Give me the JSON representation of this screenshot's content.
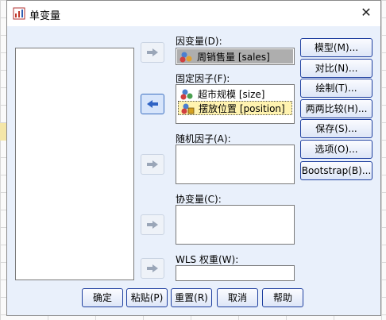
{
  "window": {
    "title": "单变量",
    "close_label": "✕"
  },
  "fields": {
    "dependent": {
      "label": "因变量(D):",
      "var": "周销售量 [sales]"
    },
    "fixed_factors": {
      "label": "固定因子(F):",
      "items": [
        "超市规模 [size]",
        "摆放位置 [position]"
      ]
    },
    "random_factors": {
      "label": "随机因子(A):"
    },
    "covariates": {
      "label": "协变量(C):"
    },
    "wls_weight": {
      "label": "WLS 权重(W):",
      "value": ""
    }
  },
  "right_buttons": [
    "模型(M)...",
    "对比(N)...",
    "绘制(T)...",
    "两两比较(H)...",
    "保存(S)...",
    "选项(O)...",
    "Bootstrap(B)..."
  ],
  "bottom_buttons": [
    "确定",
    "粘贴(P)",
    "重置(R)",
    "取消",
    "帮助"
  ],
  "colors": {
    "dialog_bg": "#e9f0fb",
    "selected_row": "#fff3b0",
    "button_border": "#1e3f9f"
  }
}
